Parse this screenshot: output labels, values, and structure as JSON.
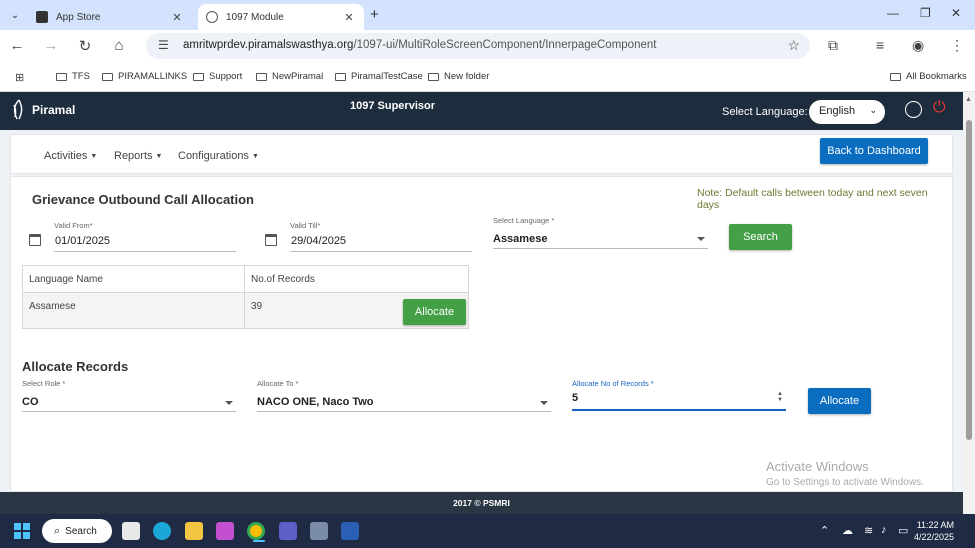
{
  "browser": {
    "tabs": [
      {
        "title": "App Store",
        "active": false
      },
      {
        "title": "1097 Module",
        "active": true
      }
    ],
    "url_host": "amritwprdev.piramalswasthya.org",
    "url_path": "/1097-ui/MultiRoleScreenComponent/InnerpageComponent",
    "bookmarks": [
      "TFS",
      "PIRAMALLINKS",
      "Support",
      "NewPiramal",
      "PiramalTestCase",
      "New folder"
    ],
    "all_bookmarks": "All Bookmarks"
  },
  "header": {
    "logo_text": "Piramal",
    "title": "1097 Supervisor",
    "language_label": "Select Language:",
    "language_value": "English"
  },
  "menu": {
    "items": [
      "Activities",
      "Reports",
      "Configurations"
    ],
    "back_button": "Back to Dashboard"
  },
  "allocation": {
    "title": "Grievance Outbound Call Allocation",
    "note": "Note: Default calls between today and next seven days",
    "valid_from_label": "Valid From*",
    "valid_from": "01/01/2025",
    "valid_till_label": "Valid Till*",
    "valid_till": "29/04/2025",
    "language_label": "Select Language *",
    "language_value": "Assamese",
    "search_button": "Search",
    "table": {
      "headers": [
        "Language Name",
        "No.of Records"
      ],
      "rows": [
        {
          "language": "Assamese",
          "records": "39"
        }
      ]
    },
    "row_allocate_button": "Allocate"
  },
  "allocate_records": {
    "title": "Allocate Records",
    "role_label": "Select Role *",
    "role_value": "CO",
    "allocate_to_label": "Allocate To *",
    "allocate_to_value": "NACO ONE, Naco Two",
    "count_label": "Allocate No of Records *",
    "count_value": "5",
    "allocate_button": "Allocate"
  },
  "watermark": {
    "line1": "Activate Windows",
    "line2": "Go to Settings to activate Windows."
  },
  "footer": {
    "text": "2017 © PSMRI"
  },
  "taskbar": {
    "search_label": "Search",
    "time": "11:22 AM",
    "date": "4/22/2025"
  }
}
